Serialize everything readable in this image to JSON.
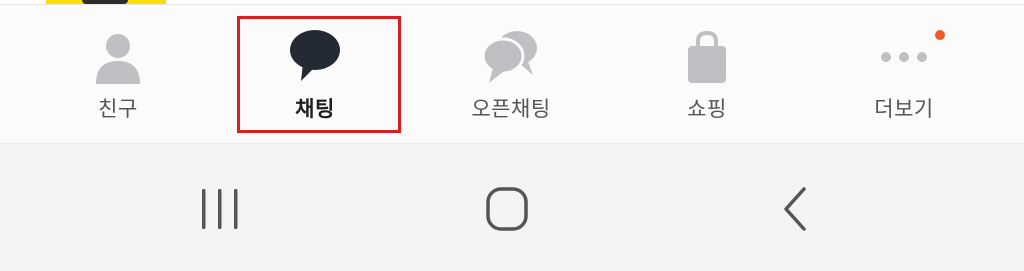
{
  "tab_bar": {
    "tabs": [
      {
        "id": "friends",
        "label": "친구",
        "icon": "person-icon",
        "active": false
      },
      {
        "id": "chat",
        "label": "채팅",
        "icon": "chat-bubble-icon",
        "active": true
      },
      {
        "id": "openchat",
        "label": "오픈채팅",
        "icon": "double-chat-bubble-icon",
        "active": false
      },
      {
        "id": "shopping",
        "label": "쇼핑",
        "icon": "shopping-bag-icon",
        "active": false
      },
      {
        "id": "more",
        "label": "더보기",
        "icon": "more-dots-icon",
        "active": false,
        "has_notification": true
      }
    ]
  },
  "nav_bar": {
    "buttons": [
      {
        "id": "recents",
        "icon": "recents-icon"
      },
      {
        "id": "home",
        "icon": "home-icon"
      },
      {
        "id": "back",
        "icon": "back-icon"
      }
    ]
  },
  "colors": {
    "active_icon": "#232a33",
    "inactive_icon": "#c0c0c4",
    "highlight_border": "#d81e1e",
    "notification_dot": "#f05a2a",
    "nav_icon": "#555555"
  }
}
